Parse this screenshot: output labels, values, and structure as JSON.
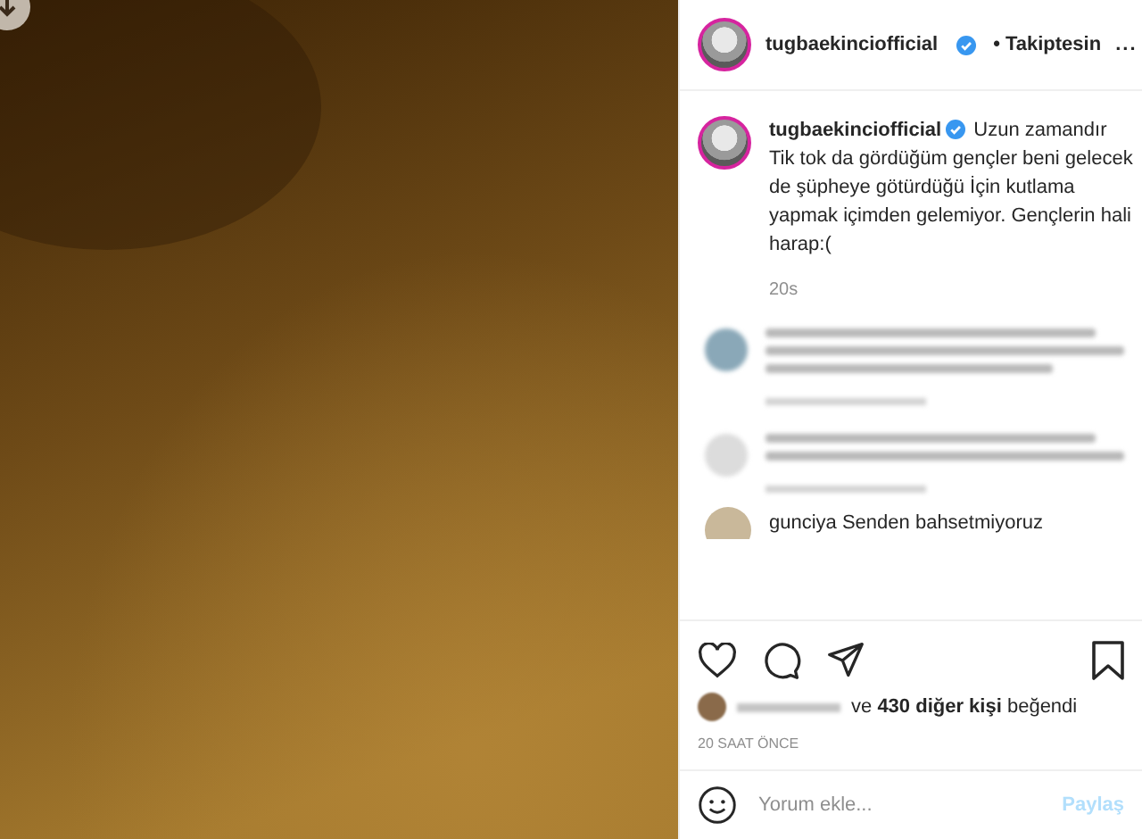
{
  "header": {
    "username": "tugbaekinciofficial",
    "verified": true,
    "follow_status": "• Takiptesin",
    "more": "..."
  },
  "caption": {
    "username": "tugbaekinciofficial",
    "verified": true,
    "text": "Uzun zamandır Tik tok da gördüğüm gençler beni gelecek de şüpheye götürdüğü İçin kutlama yapmak içimden gelemiyor. Gençlerin hali harap:(",
    "time": "20s"
  },
  "partial_comment": {
    "text": "gunciya Senden bahsetmiyoruz"
  },
  "likes": {
    "text": "ve **430 diğer kişi** beğendi"
  },
  "timestamp": "20 SAAT ÖNCE",
  "comment_field": {
    "placeholder": "Yorum ekle...",
    "button": "Paylaş"
  }
}
